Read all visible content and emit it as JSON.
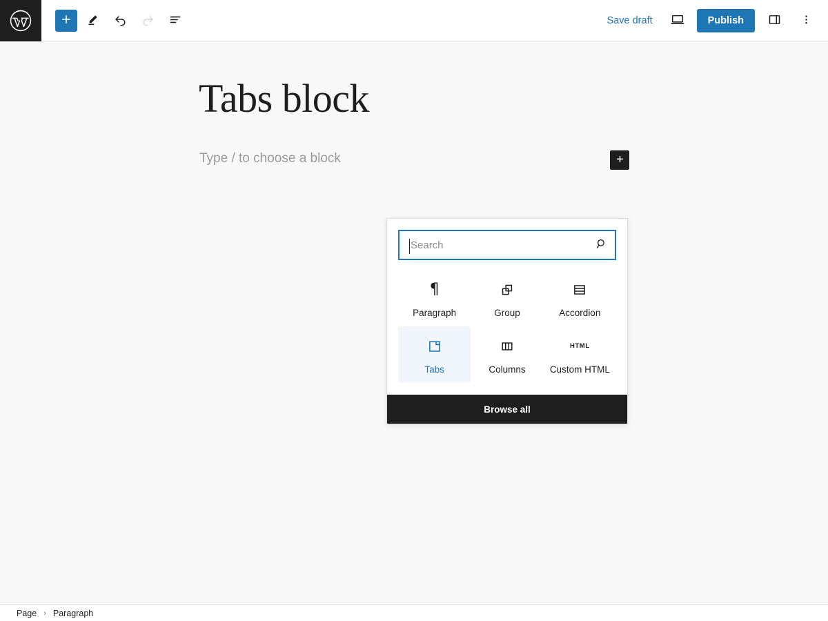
{
  "topbar": {
    "logo_icon": "wordpress-logo-icon",
    "left_tools": [
      {
        "name": "block-inserter-toggle",
        "icon": "plus-icon",
        "state": "active",
        "label": ""
      },
      {
        "name": "tools-edit-mode",
        "icon": "pencil-icon",
        "state": "default",
        "label": ""
      },
      {
        "name": "undo-button",
        "icon": "undo-arrow-icon",
        "state": "default",
        "label": ""
      },
      {
        "name": "redo-button",
        "icon": "redo-arrow-icon",
        "state": "disabled",
        "label": ""
      },
      {
        "name": "list-view-button",
        "icon": "list-view-icon",
        "state": "default",
        "label": ""
      }
    ],
    "save_draft_label": "Save draft",
    "preview_icon": "desktop-preview-icon",
    "publish_label": "Publish",
    "sidebar_toggle_icon": "sidebar-panel-icon",
    "options_icon": "three-dots-vertical-icon"
  },
  "canvas": {
    "doc_title": "Tabs block",
    "paragraph_placeholder": "Type / to choose a block",
    "inline_inserter_icon": "plus-icon"
  },
  "inserter": {
    "search": {
      "value": "",
      "placeholder": "Search",
      "icon": "search-magnifier-icon"
    },
    "blocks": [
      {
        "label": "Paragraph",
        "icon": "paragraph-pilcrow-icon",
        "selected": false
      },
      {
        "label": "Group",
        "icon": "group-overlapping-squares-icon",
        "selected": false
      },
      {
        "label": "Accordion",
        "icon": "accordion-rows-icon",
        "selected": false
      },
      {
        "label": "Tabs",
        "icon": "tabs-icon",
        "selected": true
      },
      {
        "label": "Columns",
        "icon": "columns-icon",
        "selected": false
      },
      {
        "label": "Custom HTML",
        "icon": "html-text-icon",
        "selected": false
      }
    ],
    "browse_all_label": "Browse all"
  },
  "breadcrumb": {
    "items": [
      "Page",
      "Paragraph"
    ],
    "separator": "›"
  },
  "colors": {
    "accent_blue": "#1e76b5",
    "dark": "#1e1e1e",
    "canvas_bg": "#f8f8f8",
    "selected_cell_bg": "#f0f6fb"
  }
}
